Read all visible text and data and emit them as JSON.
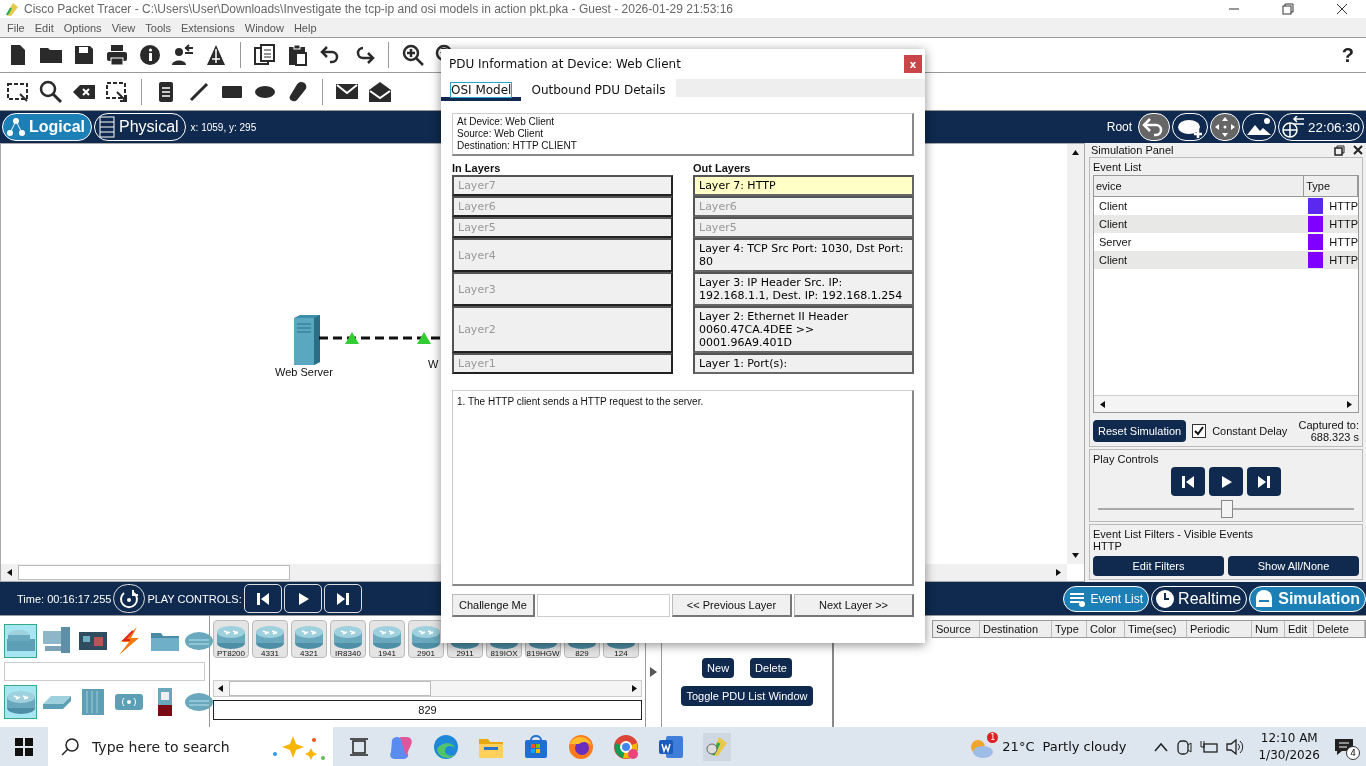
{
  "window": {
    "title": "Cisco Packet Tracer - C:\\Users\\User\\Downloads\\Investigate the tcp-ip and osi models in action pkt.pka - Guest - 2026-01-29 21:53:16"
  },
  "menu": [
    "File",
    "Edit",
    "Options",
    "View",
    "Tools",
    "Extensions",
    "Window",
    "Help"
  ],
  "help": "?",
  "workspace_tabs": [
    {
      "label": "Logical",
      "selected": true
    },
    {
      "label": "Physical",
      "selected": false
    }
  ],
  "coordinates": "x: 1059, y: 295",
  "root": "Root",
  "clock": "22:06:30",
  "canvas": {
    "server_label": "Web Server",
    "client_label": "W"
  },
  "simulation_panel": {
    "title": "Simulation Panel",
    "event_list_label": "Event List",
    "columns": [
      "evice",
      "Type"
    ],
    "rows": [
      {
        "device": "Client",
        "color": "#5b28f0",
        "type": "HTTP"
      },
      {
        "device": "Client",
        "color": "#8000ff",
        "type": "HTTP"
      },
      {
        "device": "Server",
        "color": "#8000ff",
        "type": "HTTP"
      },
      {
        "device": "Client",
        "color": "#8000ff",
        "type": "HTTP"
      }
    ],
    "reset": "Reset Simulation",
    "constant_delay": {
      "label": "Constant Delay",
      "checked": true
    },
    "captured_label": "Captured to:",
    "captured_value": "688.323 s",
    "play_controls": {
      "label": "Play Controls",
      "level": 0.5
    },
    "filters": {
      "label": "Event List Filters - Visible Events",
      "value": "HTTP",
      "buttons": [
        "Edit Filters",
        "Show All/None"
      ]
    }
  },
  "sim_bar": {
    "time": "Time: 00:16:17.255",
    "play_label": "PLAY CONTROLS:",
    "modes": [
      {
        "label": "Event List",
        "selected": true
      },
      {
        "label": "Realtime",
        "selected": false
      },
      {
        "label": "Simulation",
        "selected": true
      }
    ]
  },
  "categories": [
    {
      "selected": true
    },
    {
      "selected": false
    },
    {
      "selected": false
    },
    {
      "selected": false
    },
    {
      "selected": false
    },
    {
      "selected": false
    }
  ],
  "subcategories": [
    {
      "selected": true
    },
    {
      "selected": false
    },
    {
      "selected": false
    },
    {
      "selected": false
    },
    {
      "selected": false
    },
    {
      "selected": false
    }
  ],
  "device_models": [
    "PT8200",
    "4331",
    "4321",
    "IR8340",
    "1941",
    "2901",
    "2911",
    "819IOX",
    "819HGW",
    "829",
    "124"
  ],
  "model_field": "829",
  "pdu_panel": {
    "buttons": [
      "New",
      "Delete"
    ],
    "toggle": "Toggle PDU List Window"
  },
  "pdu_table": {
    "columns": [
      "Source",
      "Destination",
      "Type",
      "Color",
      "Time(sec)",
      "Periodic",
      "Num",
      "Edit",
      "Delete"
    ]
  },
  "dialog": {
    "title": "PDU Information at Device: Web Client",
    "close": "x",
    "tabs": [
      {
        "label": "OSI Model",
        "selected": true
      },
      {
        "label": "Outbound PDU Details",
        "selected": false
      }
    ],
    "info": [
      "At Device: Web Client",
      "Source: Web Client",
      "Destination: HTTP CLIENT"
    ],
    "in_label": "In Layers",
    "out_label": "Out Layers",
    "in_layers": [
      {
        "text": "Layer7",
        "disabled": true,
        "selected": false
      },
      {
        "text": "Layer6",
        "disabled": true,
        "selected": false
      },
      {
        "text": "Layer5",
        "disabled": true,
        "selected": false
      },
      {
        "text": "Layer4",
        "disabled": true,
        "selected": false
      },
      {
        "text": "Layer3",
        "disabled": true,
        "selected": false
      },
      {
        "text": "Layer2",
        "disabled": true,
        "selected": false
      },
      {
        "text": "Layer1",
        "disabled": true,
        "selected": false
      }
    ],
    "out_layers": [
      {
        "text": "Layer 7: HTTP",
        "disabled": false,
        "selected": true
      },
      {
        "text": "Layer6",
        "disabled": true,
        "selected": false
      },
      {
        "text": "Layer5",
        "disabled": true,
        "selected": false
      },
      {
        "text": "Layer 4: TCP Src Port: 1030, Dst Port: 80",
        "disabled": false,
        "selected": false
      },
      {
        "text": "Layer 3: IP Header Src. IP: 192.168.1.1, Dest. IP: 192.168.1.254",
        "disabled": false,
        "selected": false
      },
      {
        "text": "Layer 2: Ethernet II Header 0060.47CA.4DEE >> 0001.96A9.401D",
        "disabled": false,
        "selected": false
      },
      {
        "text": "Layer 1: Port(s):",
        "disabled": false,
        "selected": false
      }
    ],
    "description": "1. The HTTP client sends a HTTP request to the server.",
    "challenge": "Challenge Me",
    "previous": "<< Previous Layer",
    "next": "Next Layer >>"
  },
  "taskbar": {
    "search_placeholder": "Type here to search",
    "weather_badge": "1",
    "temperature": "21°C",
    "weather": "Partly cloudy",
    "time": "12:10 AM",
    "date": "1/30/2026",
    "notifications": "4"
  }
}
